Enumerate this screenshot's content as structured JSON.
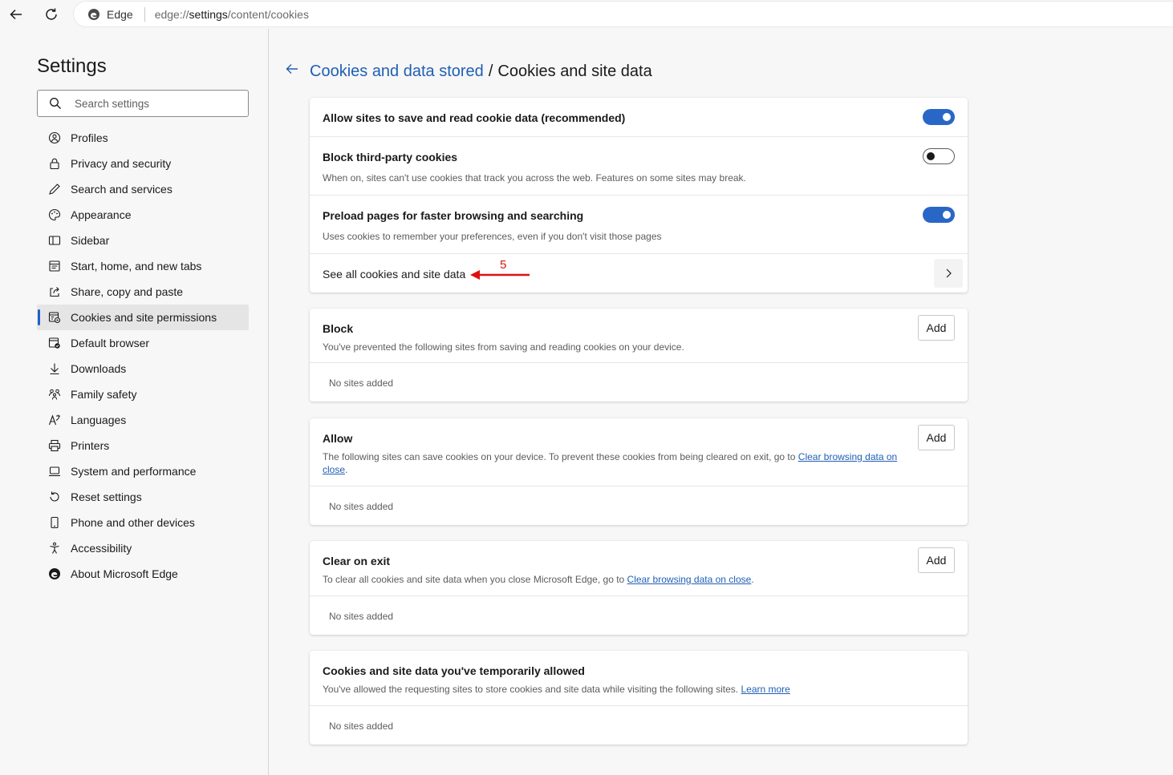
{
  "browser": {
    "brand": "Edge",
    "url_prefix": "edge://",
    "url_strong": "settings",
    "url_suffix": "/content/cookies"
  },
  "sidebar": {
    "title": "Settings",
    "search_placeholder": "Search settings",
    "items": [
      {
        "label": "Profiles",
        "icon": "profile-icon"
      },
      {
        "label": "Privacy and security",
        "icon": "lock-icon"
      },
      {
        "label": "Search and services",
        "icon": "pen-icon"
      },
      {
        "label": "Appearance",
        "icon": "palette-icon"
      },
      {
        "label": "Sidebar",
        "icon": "sidebar-icon"
      },
      {
        "label": "Start, home, and new tabs",
        "icon": "home-tabs-icon"
      },
      {
        "label": "Share, copy and paste",
        "icon": "share-icon"
      },
      {
        "label": "Cookies and site permissions",
        "icon": "cookie-permissions-icon",
        "active": true
      },
      {
        "label": "Default browser",
        "icon": "default-browser-icon"
      },
      {
        "label": "Downloads",
        "icon": "download-icon"
      },
      {
        "label": "Family safety",
        "icon": "family-icon"
      },
      {
        "label": "Languages",
        "icon": "languages-icon"
      },
      {
        "label": "Printers",
        "icon": "printer-icon"
      },
      {
        "label": "System and performance",
        "icon": "laptop-icon"
      },
      {
        "label": "Reset settings",
        "icon": "reset-icon"
      },
      {
        "label": "Phone and other devices",
        "icon": "phone-icon"
      },
      {
        "label": "Accessibility",
        "icon": "accessibility-icon"
      },
      {
        "label": "About Microsoft Edge",
        "icon": "edge-logo-icon"
      }
    ]
  },
  "header": {
    "crumb_link": "Cookies and data stored",
    "separator": "/",
    "current": "Cookies and site data"
  },
  "cookies_card": {
    "allow_title": "Allow sites to save and read cookie data (recommended)",
    "allow_on": true,
    "block_third_title": "Block third-party cookies",
    "block_third_desc": "When on, sites can't use cookies that track you across the web. Features on some sites may break.",
    "block_third_on": false,
    "preload_title": "Preload pages for faster browsing and searching",
    "preload_desc": "Uses cookies to remember your preferences, even if you don't visit those pages",
    "preload_on": true,
    "see_all_title": "See all cookies and site data"
  },
  "annotation": {
    "number": "5",
    "color": "#e01010"
  },
  "block_card": {
    "title": "Block",
    "desc": "You've prevented the following sites from saving and reading cookies on your device.",
    "add_label": "Add",
    "empty": "No sites added"
  },
  "allow_card": {
    "title": "Allow",
    "desc_prefix": "The following sites can save cookies on your device. To prevent these cookies from being cleared on exit, go to ",
    "desc_link": "Clear browsing data on close",
    "desc_suffix": ".",
    "add_label": "Add",
    "empty": "No sites added"
  },
  "clear_card": {
    "title": "Clear on exit",
    "desc_prefix": "To clear all cookies and site data when you close Microsoft Edge, go to ",
    "desc_link": "Clear browsing data on close",
    "desc_suffix": ".",
    "add_label": "Add",
    "empty": "No sites added"
  },
  "temp_card": {
    "title": "Cookies and site data you've temporarily allowed",
    "desc_prefix": "You've allowed the requesting sites to store cookies and site data while visiting the following sites. ",
    "desc_link": "Learn more",
    "empty": "No sites added"
  },
  "colors": {
    "accent": "#2967c7",
    "link": "#1f5fb4"
  }
}
